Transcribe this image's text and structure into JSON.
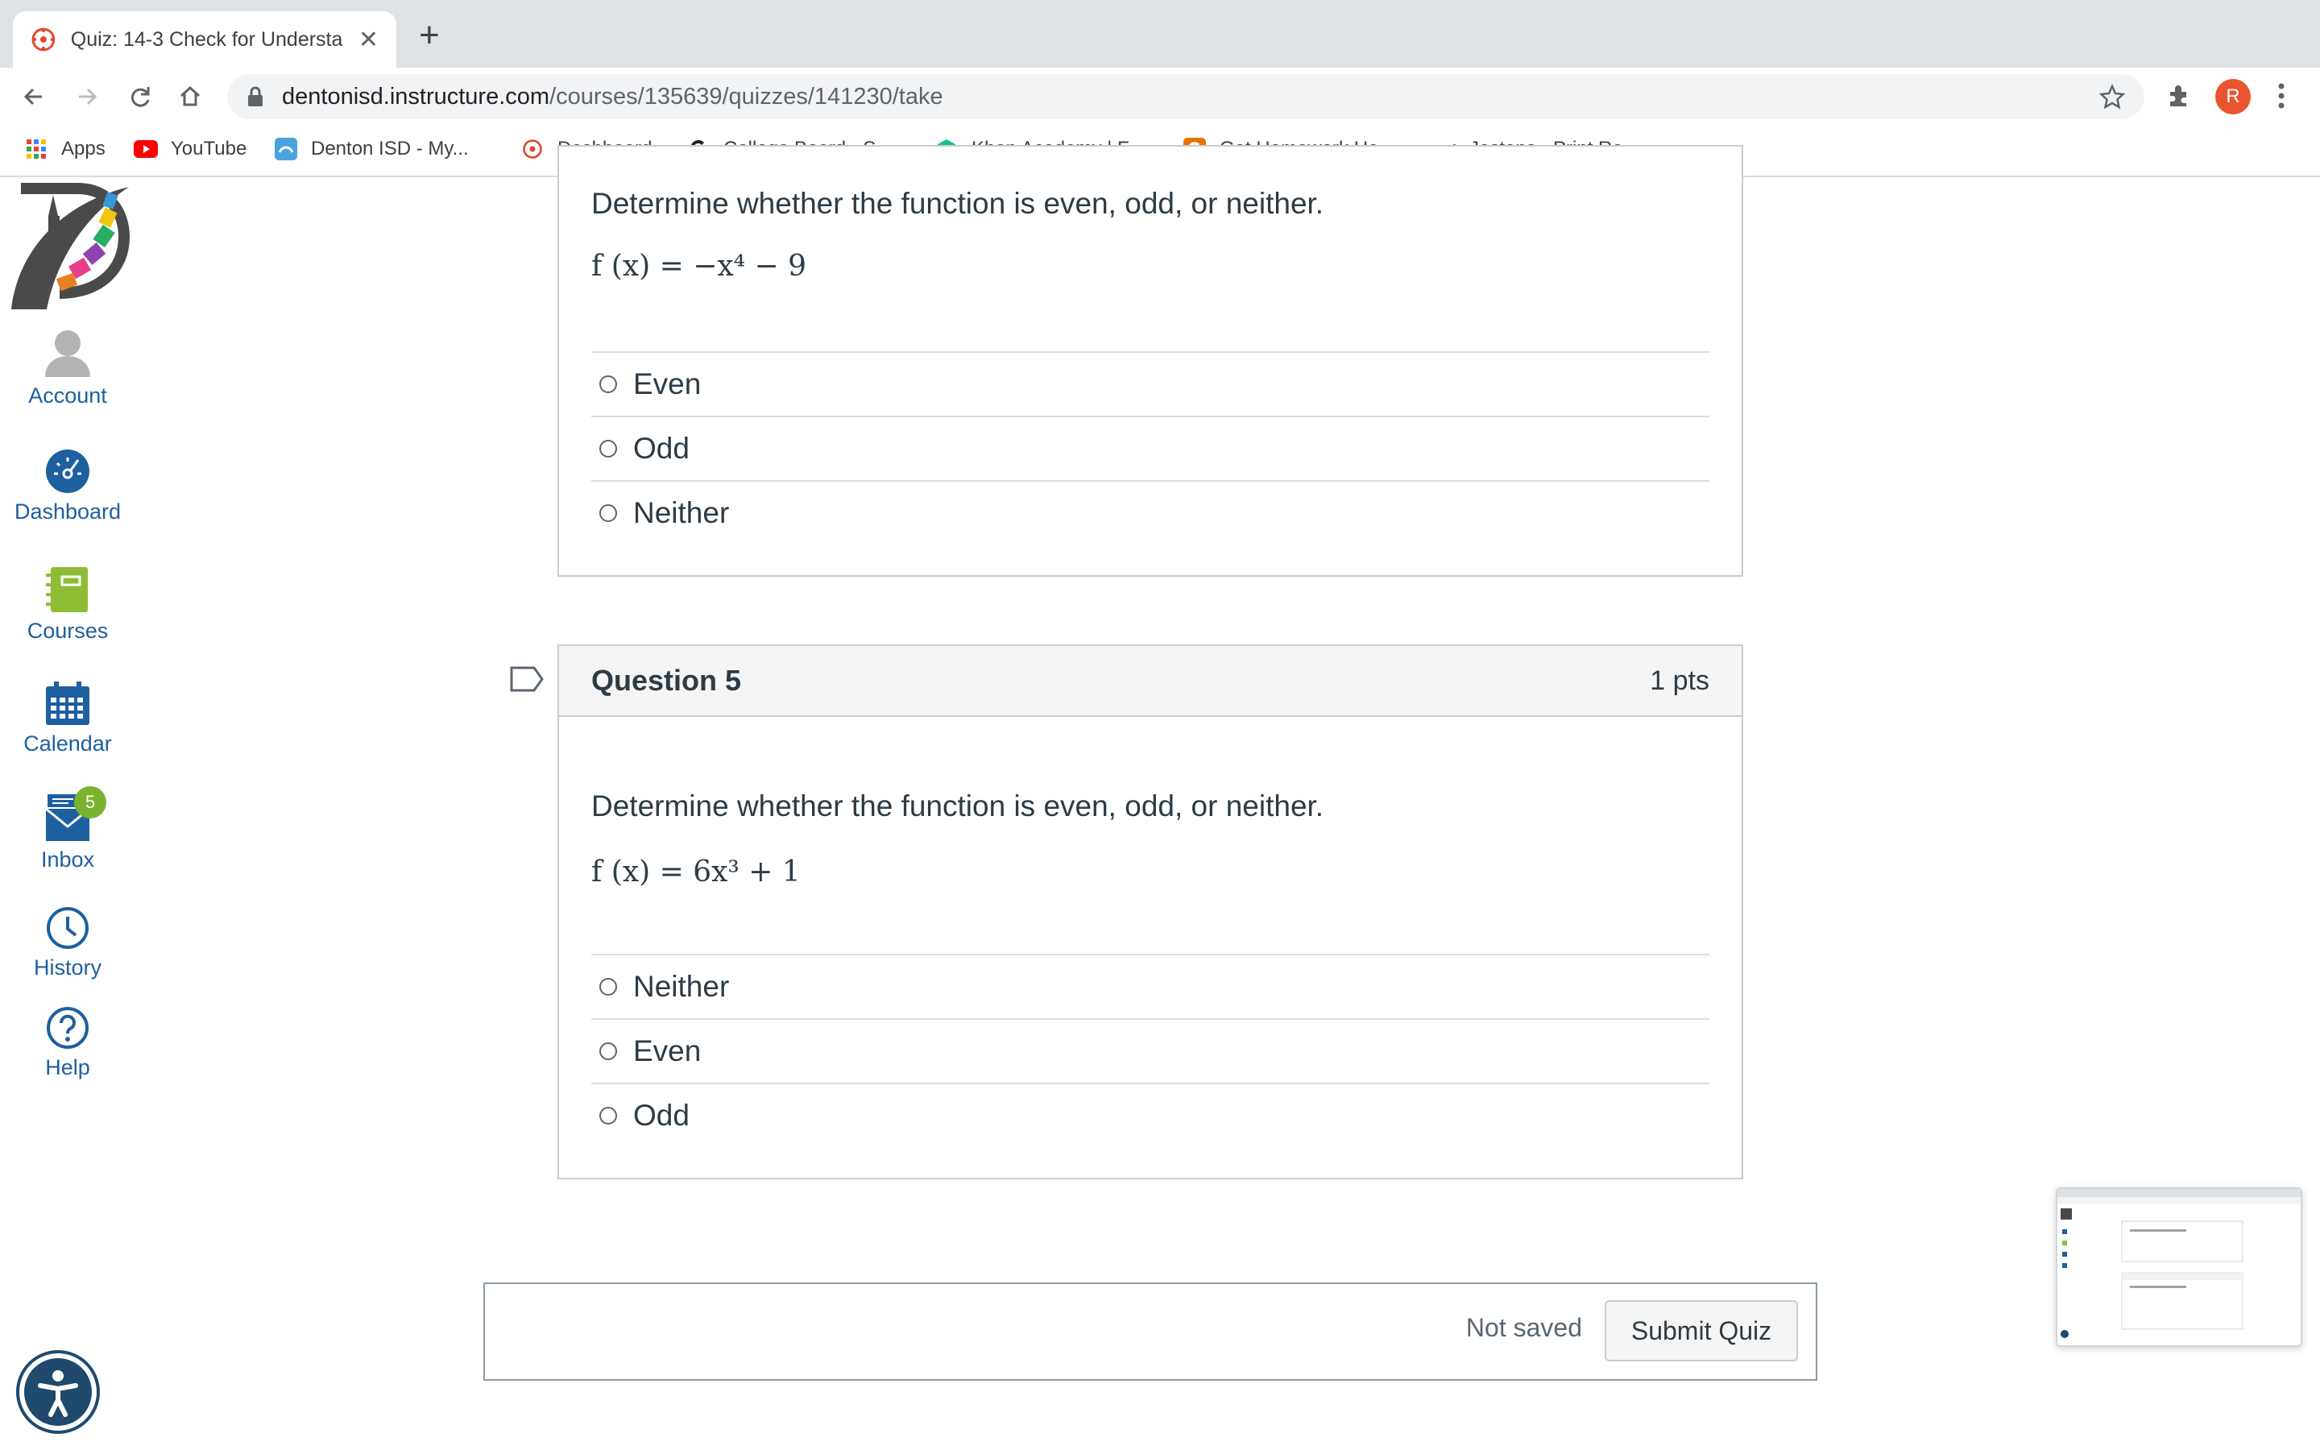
{
  "browser": {
    "tab_title": "Quiz: 14-3 Check for Understa",
    "url_host": "dentonisd.instructure.com",
    "url_path": "/courses/135639/quizzes/141230/take",
    "profile_initial": "R"
  },
  "bookmarks": [
    {
      "label": "Apps",
      "icon": "apps-grid-icon"
    },
    {
      "label": "YouTube",
      "icon": "youtube-icon"
    },
    {
      "label": "Denton ISD - My...",
      "icon": "denton-isd-icon"
    },
    {
      "label": "Dashboard",
      "icon": "canvas-icon"
    },
    {
      "label": "College Board - S...",
      "icon": "college-board-icon"
    },
    {
      "label": "Khan Academy | F...",
      "icon": "khan-academy-icon"
    },
    {
      "label": "Get Homework He...",
      "icon": "chegg-icon"
    },
    {
      "label": "Jostens - Print Re...",
      "icon": "jostens-icon"
    }
  ],
  "nav": {
    "account": "Account",
    "dashboard": "Dashboard",
    "courses": "Courses",
    "calendar": "Calendar",
    "inbox": "Inbox",
    "inbox_badge": "5",
    "history": "History",
    "help": "Help"
  },
  "question4": {
    "text": "Determine whether the function is even, odd, or neither.",
    "equation": "f (x) = −x⁴ − 9",
    "answers": [
      "Even",
      "Odd",
      "Neither"
    ]
  },
  "question5": {
    "name": "Question 5",
    "points": "1 pts",
    "text": "Determine whether the function is even, odd, or neither.",
    "equation": "f (x) = 6x³ + 1",
    "answers": [
      "Neither",
      "Even",
      "Odd"
    ]
  },
  "submit": {
    "status": "Not saved",
    "button": "Submit Quiz"
  },
  "colors": {
    "canvas_blue": "#1e5fa0",
    "courses_green": "#8cbd34",
    "badge_green": "#7ab42e",
    "profile_orange": "#e8552f"
  }
}
